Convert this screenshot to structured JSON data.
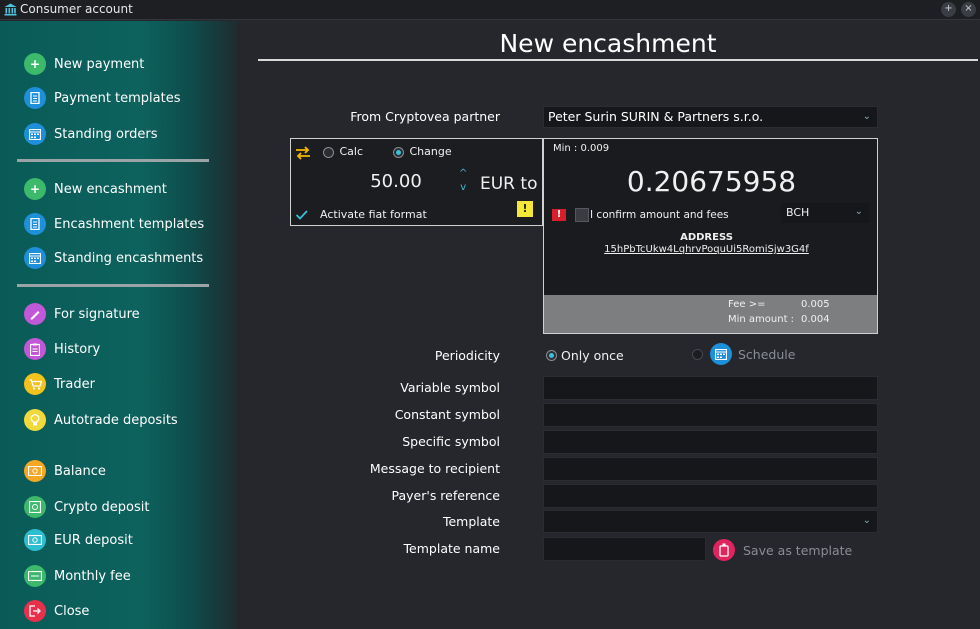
{
  "window": {
    "title": "Consumer account",
    "btn_plus": "+",
    "btn_close": "×"
  },
  "sidebar": {
    "items": [
      {
        "label": "New payment",
        "icon": "plus-circle-icon",
        "color": "#3cb96b"
      },
      {
        "label": "Payment templates",
        "icon": "document-icon",
        "color": "#1e8fd9"
      },
      {
        "label": "Standing orders",
        "icon": "calendar-icon",
        "color": "#1e8fd9"
      },
      {
        "label": "New encashment",
        "icon": "plus-circle-icon",
        "color": "#3cb96b"
      },
      {
        "label": "Encashment templates",
        "icon": "document-icon",
        "color": "#1e8fd9"
      },
      {
        "label": "Standing encashments",
        "icon": "calendar-icon",
        "color": "#1e8fd9"
      },
      {
        "label": "For signature",
        "icon": "pen-icon",
        "color": "#c158d8"
      },
      {
        "label": "History",
        "icon": "clipboard-icon",
        "color": "#c158d8"
      },
      {
        "label": "Trader",
        "icon": "cart-icon",
        "color": "#f2c31c"
      },
      {
        "label": "Autotrade deposits",
        "icon": "lightbulb-icon",
        "color": "#f2d93a"
      },
      {
        "label": "Balance",
        "icon": "cash-icon",
        "color": "#f5a623"
      },
      {
        "label": "Crypto deposit",
        "icon": "safe-icon",
        "color": "#3cb96b"
      },
      {
        "label": "EUR deposit",
        "icon": "banknote-icon",
        "color": "#2cbfcf"
      },
      {
        "label": "Monthly fee",
        "icon": "money-icon",
        "color": "#3cb96b"
      },
      {
        "label": "Close",
        "icon": "exit-icon",
        "color": "#e8304c"
      }
    ]
  },
  "main": {
    "title": "New encashment",
    "partner_label": "From Cryptovea partner",
    "partner_value": "Peter Surin SURIN & Partners s.r.o.",
    "calc": {
      "swap_icon": "swap-arrows-icon",
      "opt_calc": "Calc",
      "opt_change": "Change",
      "selected": "Change",
      "amount": "50.00",
      "currency": "EUR to",
      "up": "^",
      "down": "v",
      "activate_fiat": "Activate fiat format",
      "warn": "!"
    },
    "crypto": {
      "min": "Min :  0.009",
      "amount": "0.20675958",
      "confirm": "I confirm amount and fees",
      "alert": "!",
      "coin": "BCH",
      "address_label": "ADDRESS",
      "address": "15hPbTcUkw4LqhrvPoquUi5RomiSjw3G4f",
      "fee_label": "Fee >=",
      "fee_value": "0.005",
      "min_amount_label": "Min amount :",
      "min_amount_value": "0.004"
    },
    "periodicity": {
      "label": "Periodicity",
      "opt_once": "Only once",
      "opt_schedule": "Schedule",
      "selected": "Only once"
    },
    "fields": [
      {
        "label": "Variable symbol",
        "value": ""
      },
      {
        "label": "Constant symbol",
        "value": ""
      },
      {
        "label": "Specific symbol",
        "value": ""
      },
      {
        "label": "Message to recipient",
        "value": ""
      },
      {
        "label": "Payer's reference",
        "value": ""
      }
    ],
    "template_label": "Template",
    "template_value": "",
    "template_name_label": "Template name",
    "template_name_value": "",
    "save_template": "Save as template"
  }
}
